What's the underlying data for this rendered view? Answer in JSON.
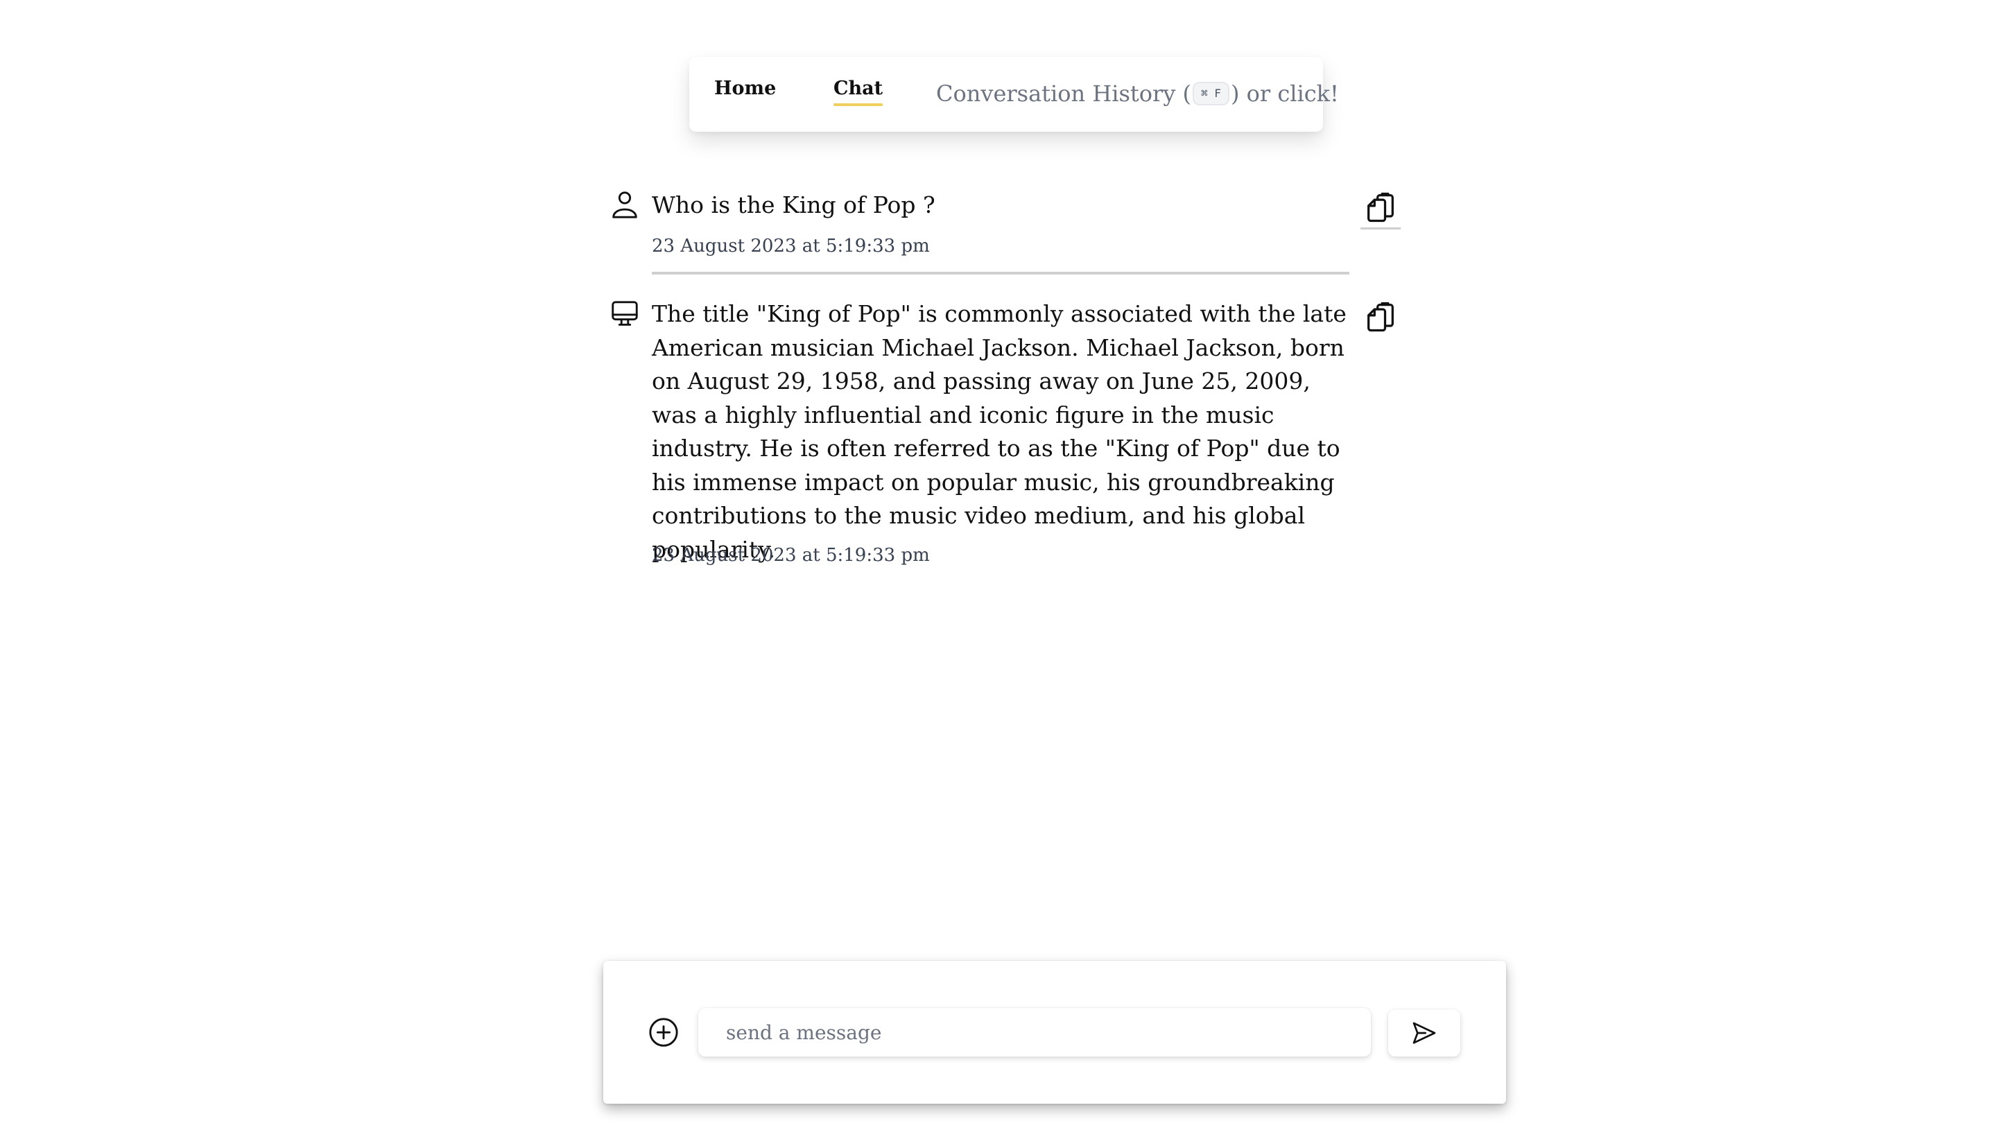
{
  "nav": {
    "home_label": "Home",
    "chat_label": "Chat",
    "history_prefix": "Conversation History (",
    "history_shortcut": "⌘ F",
    "history_suffix": ") or click!"
  },
  "conversation": {
    "messages": [
      {
        "role": "user",
        "icon": "user-icon",
        "text": "Who is the King of Pop ?",
        "timestamp": "23 August 2023 at 5:19:33 pm"
      },
      {
        "role": "assistant",
        "icon": "monitor-icon",
        "text": "The title \"King of Pop\" is commonly associated with the late American musician Michael Jackson. Michael Jackson, born on August 29, 1958, and passing away on June 25, 2009, was a highly influential and iconic figure in the music industry. He is often referred to as the \"King of Pop\" due to his immense impact on popular music, his groundbreaking contributions to the music video medium, and his global popularity.",
        "timestamp": "23 August 2023 at 5:19:33 pm"
      }
    ]
  },
  "composer": {
    "placeholder": "send a message",
    "value": "",
    "add_icon": "plus-circle-icon",
    "send_icon": "send-icon"
  },
  "colors": {
    "active_tab_underline": "#f0cf5a",
    "muted_text": "#6b7280",
    "divider": "#cfcfcf"
  }
}
